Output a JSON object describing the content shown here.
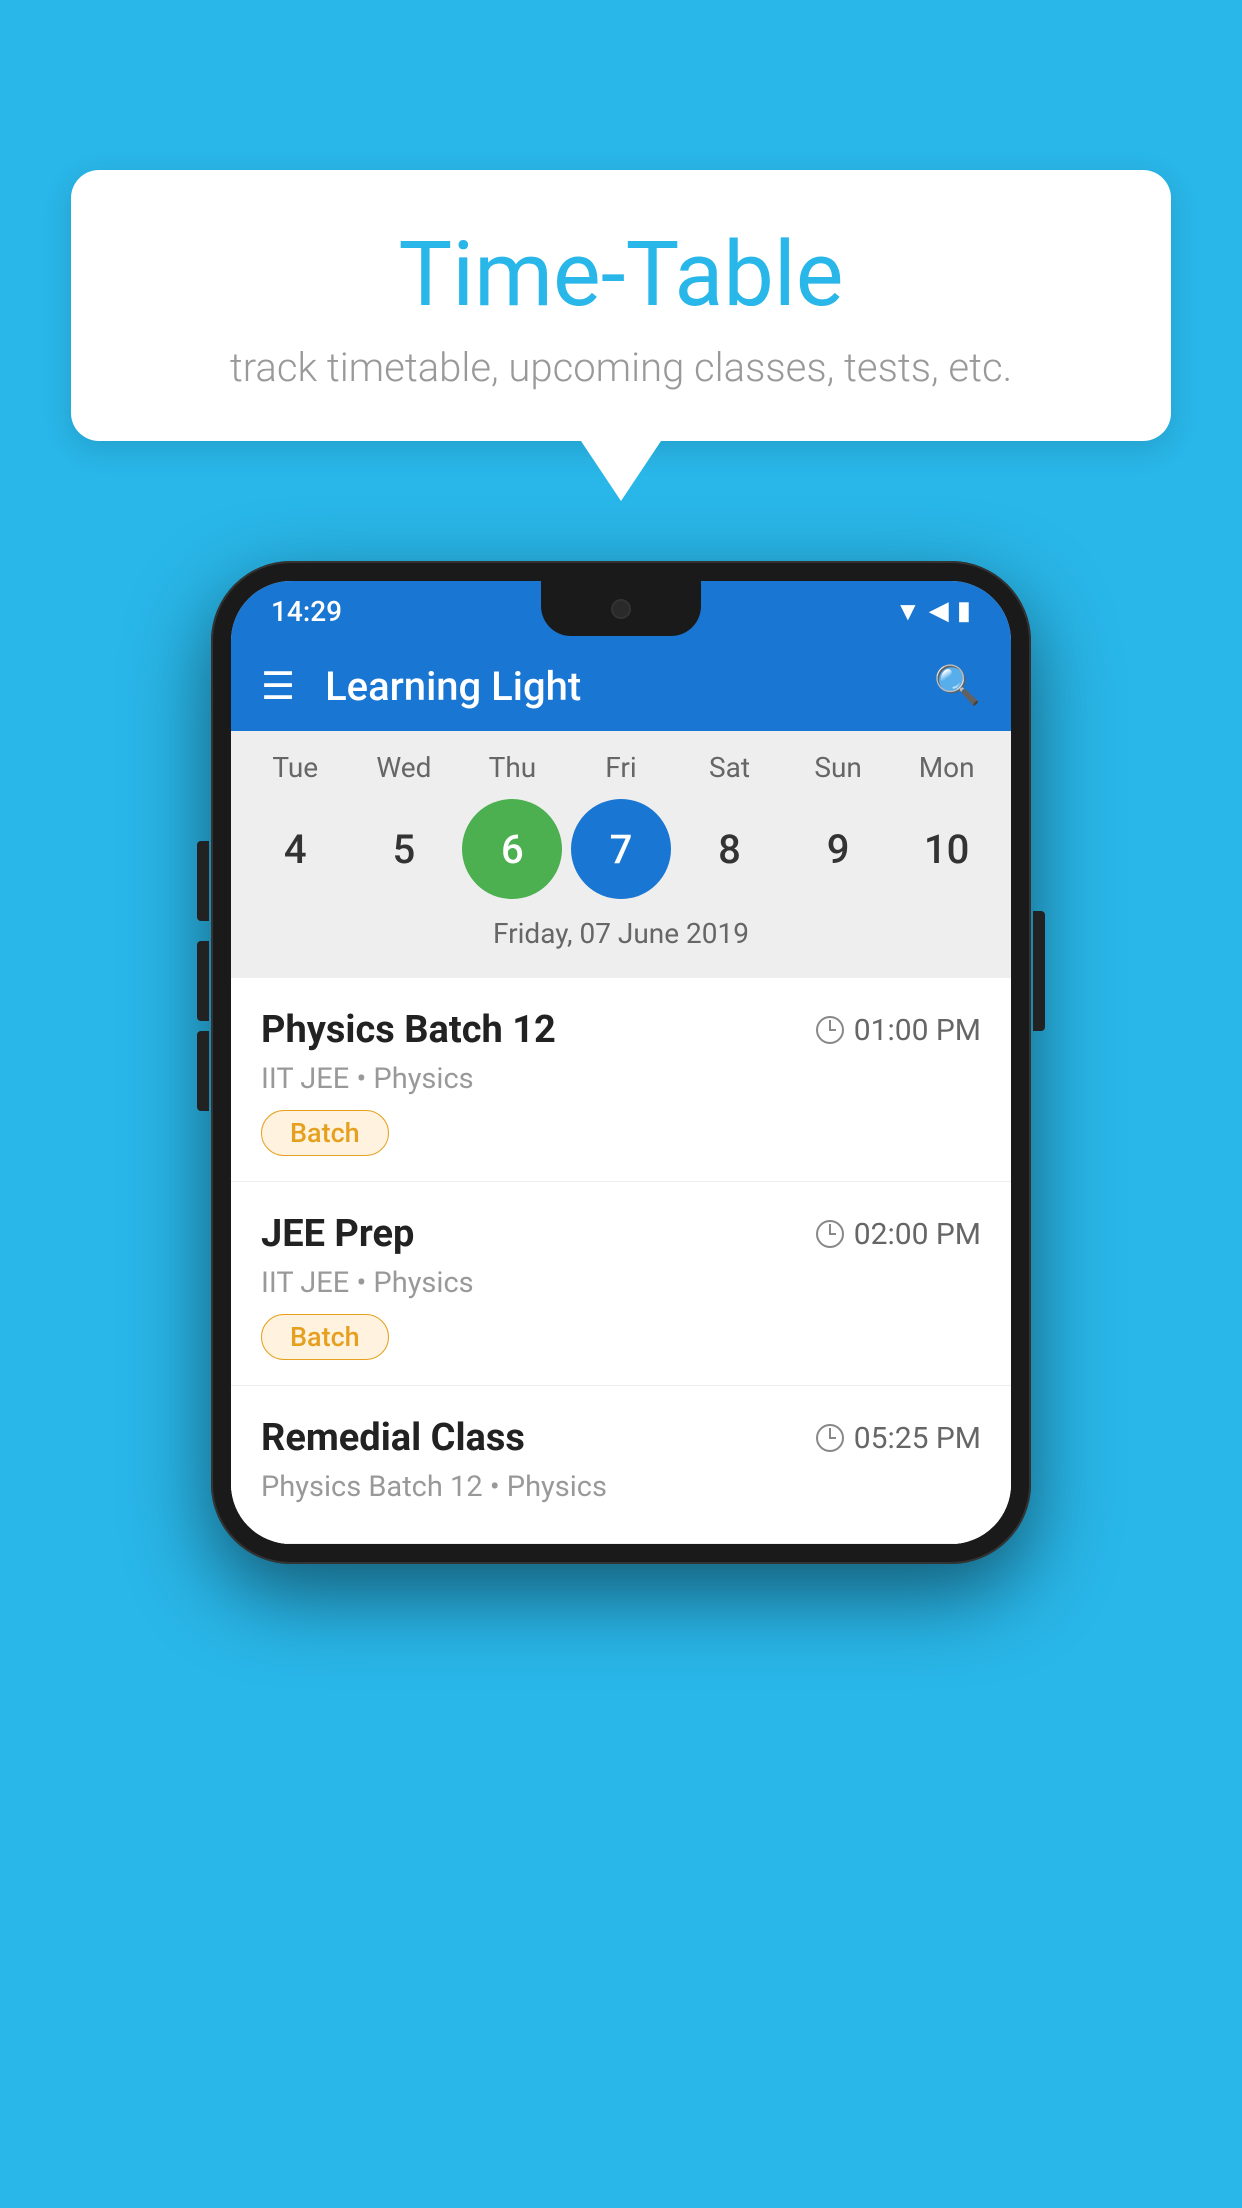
{
  "page": {
    "background_color": "#29b6e8"
  },
  "speech_bubble": {
    "title": "Time-Table",
    "subtitle": "track timetable, upcoming classes, tests, etc."
  },
  "status_bar": {
    "time": "14:29"
  },
  "app_bar": {
    "title": "Learning Light"
  },
  "calendar": {
    "days": [
      "Tue",
      "Wed",
      "Thu",
      "Fri",
      "Sat",
      "Sun",
      "Mon"
    ],
    "dates": [
      "4",
      "5",
      "6",
      "7",
      "8",
      "9",
      "10"
    ],
    "today_index": 2,
    "selected_index": 3,
    "selected_label": "Friday, 07 June 2019"
  },
  "schedule_items": [
    {
      "name": "Physics Batch 12",
      "time": "01:00 PM",
      "subtitle": "IIT JEE • Physics",
      "tag": "Batch"
    },
    {
      "name": "JEE Prep",
      "time": "02:00 PM",
      "subtitle": "IIT JEE • Physics",
      "tag": "Batch"
    },
    {
      "name": "Remedial Class",
      "time": "05:25 PM",
      "subtitle": "Physics Batch 12 • Physics",
      "tag": ""
    }
  ]
}
